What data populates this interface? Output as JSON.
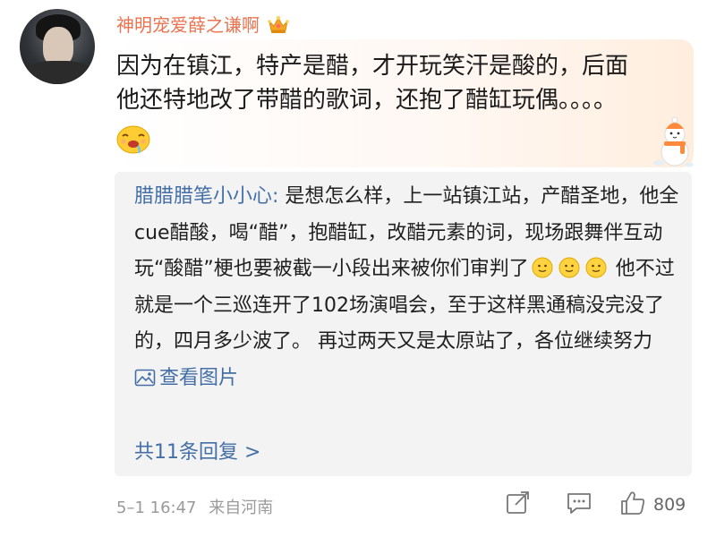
{
  "comment": {
    "username": "神明宠爱薛之谦啊",
    "text_line1": "因为在镇江，特产是醋，才开玩笑汗是酸的，后面",
    "text_line2": "他还特地改了带醋的歌词，还抱了醋缸玩偶。。。。"
  },
  "reply": {
    "author": "腊腊腊笔小小心:",
    "text_part1": " 是想怎么样，上一站镇江站，产醋圣地，他全cue醋酸，喝“醋”，抱醋缸，改醋元素的词，现场跟舞伴互动玩“酸醋”梗也要被截一小段出来被你们审判了",
    "text_part2": " 他不过就是一个三巡连开了102场演唱会，至于这样黑通稿没完没了的，四月多少波了。 再过两天又是太原站了，各位继续努力",
    "view_image_label": "查看图片",
    "more_replies_label": "共11条回复 >"
  },
  "meta": {
    "timestamp": "5–1 16:47",
    "location": "来自河南"
  },
  "actions": {
    "like_count": "809"
  },
  "colors": {
    "username": "#eb7350",
    "link": "#446fa6",
    "meta": "#9a9a9a"
  },
  "icons": [
    "crown-badge-icon",
    "drooling-face-emoji",
    "snowman-sticker",
    "slight-smile-emoji",
    "picture-icon",
    "share-icon",
    "comment-icon",
    "like-icon"
  ]
}
